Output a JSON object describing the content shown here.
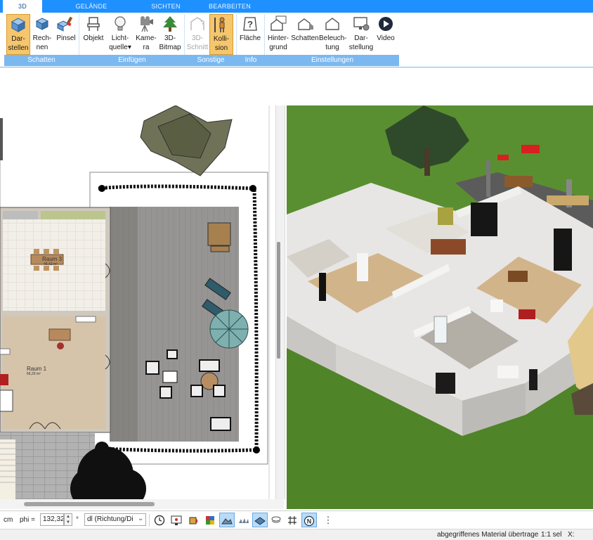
{
  "tabs": [
    {
      "label": "3D",
      "active": true
    },
    {
      "label": "GELÄNDE",
      "active": false
    },
    {
      "label": "SICHTEN",
      "active": false
    },
    {
      "label": "BEARBEITEN",
      "active": false
    }
  ],
  "ribbon": {
    "buttons": {
      "darstellen": {
        "label1": "Dar-",
        "label2": "stellen",
        "icon": "cube-icon",
        "active": true
      },
      "rechnen": {
        "label1": "Rech-",
        "label2": "nen",
        "icon": "cube-calc-icon"
      },
      "pinsel": {
        "label1": "Pinsel",
        "label2": "",
        "icon": "brush-icon"
      },
      "objekt": {
        "label1": "Objekt",
        "label2": "",
        "icon": "chair-icon"
      },
      "lichtquelle": {
        "label1": "Licht-",
        "label2": "quelle",
        "icon": "bulb-icon"
      },
      "kamera": {
        "label1": "Kame-",
        "label2": "ra",
        "icon": "camera-icon"
      },
      "bitmap": {
        "label1": "3D-",
        "label2": "Bitmap",
        "icon": "tree-icon"
      },
      "schnitt": {
        "label1": "3D-",
        "label2": "Schnitt",
        "icon": "section-icon",
        "disabled": true
      },
      "kollision": {
        "label1": "Kolli-",
        "label2": "sion",
        "icon": "person-icon",
        "active": true
      },
      "flaeche": {
        "label1": "Fläche",
        "label2": "",
        "icon": "area-question-icon"
      },
      "hintergrund": {
        "label1": "Hinter-",
        "label2": "grund",
        "icon": "house-background-icon"
      },
      "schatten": {
        "label1": "Schatten",
        "label2": "",
        "icon": "house-shadow-icon"
      },
      "beleuchtung": {
        "label1": "Beleuch-",
        "label2": "tung",
        "icon": "house-light-icon"
      },
      "darstellung": {
        "label1": "Dar-",
        "label2": "stellung",
        "icon": "monitor-settings-icon"
      },
      "video": {
        "label1": "Video",
        "label2": "",
        "icon": "play-icon"
      }
    },
    "groups": {
      "schatten": "Schatten",
      "einfuegen": "Einfügen",
      "sonstige": "Sonstige",
      "info": "Info",
      "einstellungen": "Einstellungen"
    }
  },
  "plan": {
    "rooms": [
      {
        "name": "Raum 3",
        "area": "45,42 m²"
      },
      {
        "name": "Raum 1",
        "area": "66,29 m²"
      }
    ]
  },
  "toolbar": {
    "unit": "cm",
    "phi_label": "phi =",
    "phi_value": "132,32",
    "degree": "°",
    "dl_label": "dl (Richtung/Di"
  },
  "status": {
    "message": "abgegriffenes Material übertrage",
    "scale": "1:1 sel",
    "x_label": "X:"
  },
  "colors": {
    "accent": "#1e90ff",
    "ribbon_group": "#7cb8f0",
    "active_button": "#f6c66c",
    "grass": "#4e8228"
  }
}
